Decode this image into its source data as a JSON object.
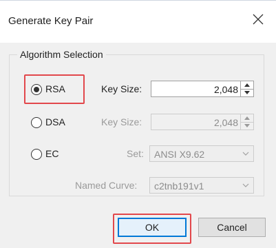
{
  "dialog": {
    "title": "Generate Key Pair"
  },
  "group": {
    "legend": "Algorithm Selection"
  },
  "algorithms": {
    "rsa": {
      "label": "RSA",
      "selected": true
    },
    "dsa": {
      "label": "DSA",
      "selected": false
    },
    "ec": {
      "label": "EC",
      "selected": false
    }
  },
  "rsa_keysize": {
    "label": "Key Size:",
    "value": "2,048"
  },
  "dsa_keysize": {
    "label": "Key Size:",
    "value": "2,048"
  },
  "ec_set": {
    "label": "Set:",
    "value": "ANSI X9.62"
  },
  "ec_curve": {
    "label": "Named Curve:",
    "value": "c2tnb191v1"
  },
  "buttons": {
    "ok": "OK",
    "cancel": "Cancel"
  },
  "icons": {
    "close": "close-icon",
    "spin_up": "spin-up-icon",
    "spin_down": "spin-down-icon",
    "chevron": "chevron-down-icon"
  },
  "colors": {
    "highlight": "#e2474b",
    "default_button_border": "#0078d7",
    "dialog_bg": "#f0f0f0"
  }
}
